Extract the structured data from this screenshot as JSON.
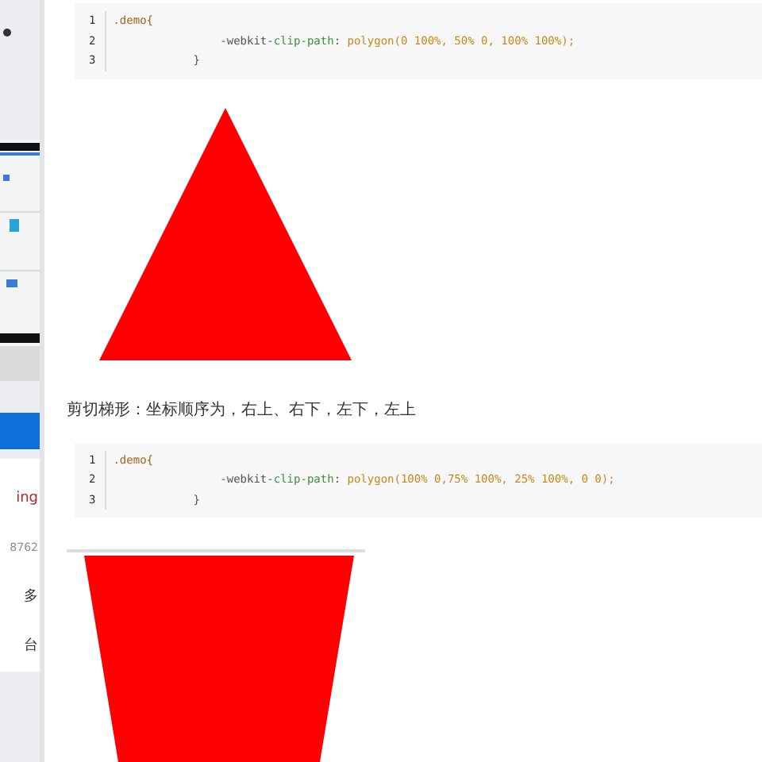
{
  "sidebar": {
    "items": [
      {
        "kind": "picture"
      },
      {
        "kind": "bar"
      },
      {
        "kind": "link",
        "text": "ing"
      },
      {
        "kind": "muted",
        "text": "8762"
      },
      {
        "kind": "text",
        "text": "多"
      },
      {
        "kind": "text",
        "text": "台"
      }
    ]
  },
  "content": [
    {
      "kind": "code",
      "lines": [
        {
          "number": "1",
          "tokens": [
            {
              "kind": "selector",
              "text": ".demo{"
            }
          ]
        },
        {
          "number": "2",
          "tokens": [
            {
              "kind": "prefix",
              "text": "                -webkit-"
            },
            {
              "kind": "property",
              "text": "clip-path"
            },
            {
              "kind": "punct",
              "text": ": "
            },
            {
              "kind": "value",
              "text": "polygon(0 100%, 50% 0, 100% 100%);"
            }
          ]
        },
        {
          "number": "3",
          "tokens": [
            {
              "kind": "punct",
              "text": "            }"
            }
          ]
        }
      ]
    },
    {
      "kind": "triangle"
    },
    {
      "kind": "caption",
      "text": "剪切梯形：坐标顺序为，右上、右下，左下，左上"
    },
    {
      "kind": "code",
      "lines": [
        {
          "number": "1",
          "tokens": [
            {
              "kind": "selector",
              "text": ".demo{"
            }
          ]
        },
        {
          "number": "2",
          "tokens": [
            {
              "kind": "prefix",
              "text": "                -webkit-"
            },
            {
              "kind": "property",
              "text": "clip-path"
            },
            {
              "kind": "punct",
              "text": ": "
            },
            {
              "kind": "value",
              "text": "polygon(100% 0,75% 100%, 25% 100%, 0 0);"
            }
          ]
        },
        {
          "number": "3",
          "tokens": [
            {
              "kind": "punct",
              "text": "            }"
            }
          ]
        }
      ]
    },
    {
      "kind": "rule"
    },
    {
      "kind": "trapezoid"
    }
  ]
}
